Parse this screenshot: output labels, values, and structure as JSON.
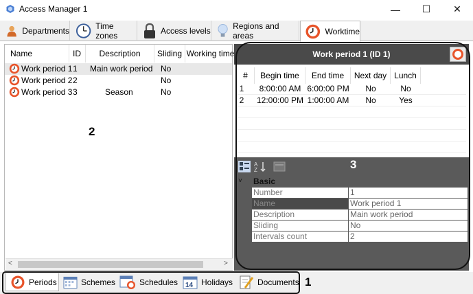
{
  "window": {
    "title": "Access Manager 1",
    "minimize": "—",
    "maximize": "☐",
    "close": "✕"
  },
  "top_tabs": [
    {
      "label": "Departments",
      "icon": "person-icon"
    },
    {
      "label": "Time zones",
      "icon": "clock-icon"
    },
    {
      "label": "Access levels",
      "icon": "padlock-icon"
    },
    {
      "label": "Regions and areas",
      "icon": "lightbulb-icon"
    },
    {
      "label": "Worktime",
      "icon": "worktime-clock-icon",
      "active": true
    }
  ],
  "periods_list": {
    "columns": [
      "Name",
      "ID",
      "Description",
      "Sliding",
      "Working time"
    ],
    "rows": [
      {
        "name": "Work period 1",
        "id": "1",
        "description": "Main work period",
        "sliding": "No",
        "working_time": ""
      },
      {
        "name": "Work period 2",
        "id": "2",
        "description": "",
        "sliding": "No",
        "working_time": ""
      },
      {
        "name": "Work period 3",
        "id": "3",
        "description": "Season",
        "sliding": "No",
        "working_time": ""
      }
    ]
  },
  "detail": {
    "header": "Work period 1 (ID 1)",
    "intervals": {
      "columns": [
        "#",
        "Begin time",
        "End time",
        "Next day",
        "Lunch"
      ],
      "rows": [
        {
          "num": "1",
          "begin": "8:00:00 AM",
          "end": "6:00:00 PM",
          "next_day": "No",
          "lunch": "No"
        },
        {
          "num": "2",
          "begin": "12:00:00 PM",
          "end": "1:00:00 AM",
          "next_day": "No",
          "lunch": "Yes"
        }
      ]
    },
    "properties": {
      "category": "Basic",
      "items": [
        {
          "key": "Number",
          "value": "1"
        },
        {
          "key": "Name",
          "value": "Work period 1"
        },
        {
          "key": "Description",
          "value": "Main work period"
        },
        {
          "key": "Sliding",
          "value": "No"
        },
        {
          "key": "Intervals count",
          "value": "2"
        }
      ]
    }
  },
  "bottom_tabs": [
    {
      "label": "Periods",
      "icon": "worktime-clock-icon",
      "active": true
    },
    {
      "label": "Schemes",
      "icon": "calendar-icon"
    },
    {
      "label": "Schedules",
      "icon": "calendar-clock-icon"
    },
    {
      "label": "Holidays",
      "icon": "calendar-14-icon"
    },
    {
      "label": "Documents",
      "icon": "document-pencil-icon"
    }
  ],
  "callouts": {
    "one": "1",
    "two": "2",
    "three": "3"
  },
  "colors": {
    "accent": "#e8542a",
    "dark_header": "#4a4a4a",
    "props_bg": "#5a5a5a"
  }
}
